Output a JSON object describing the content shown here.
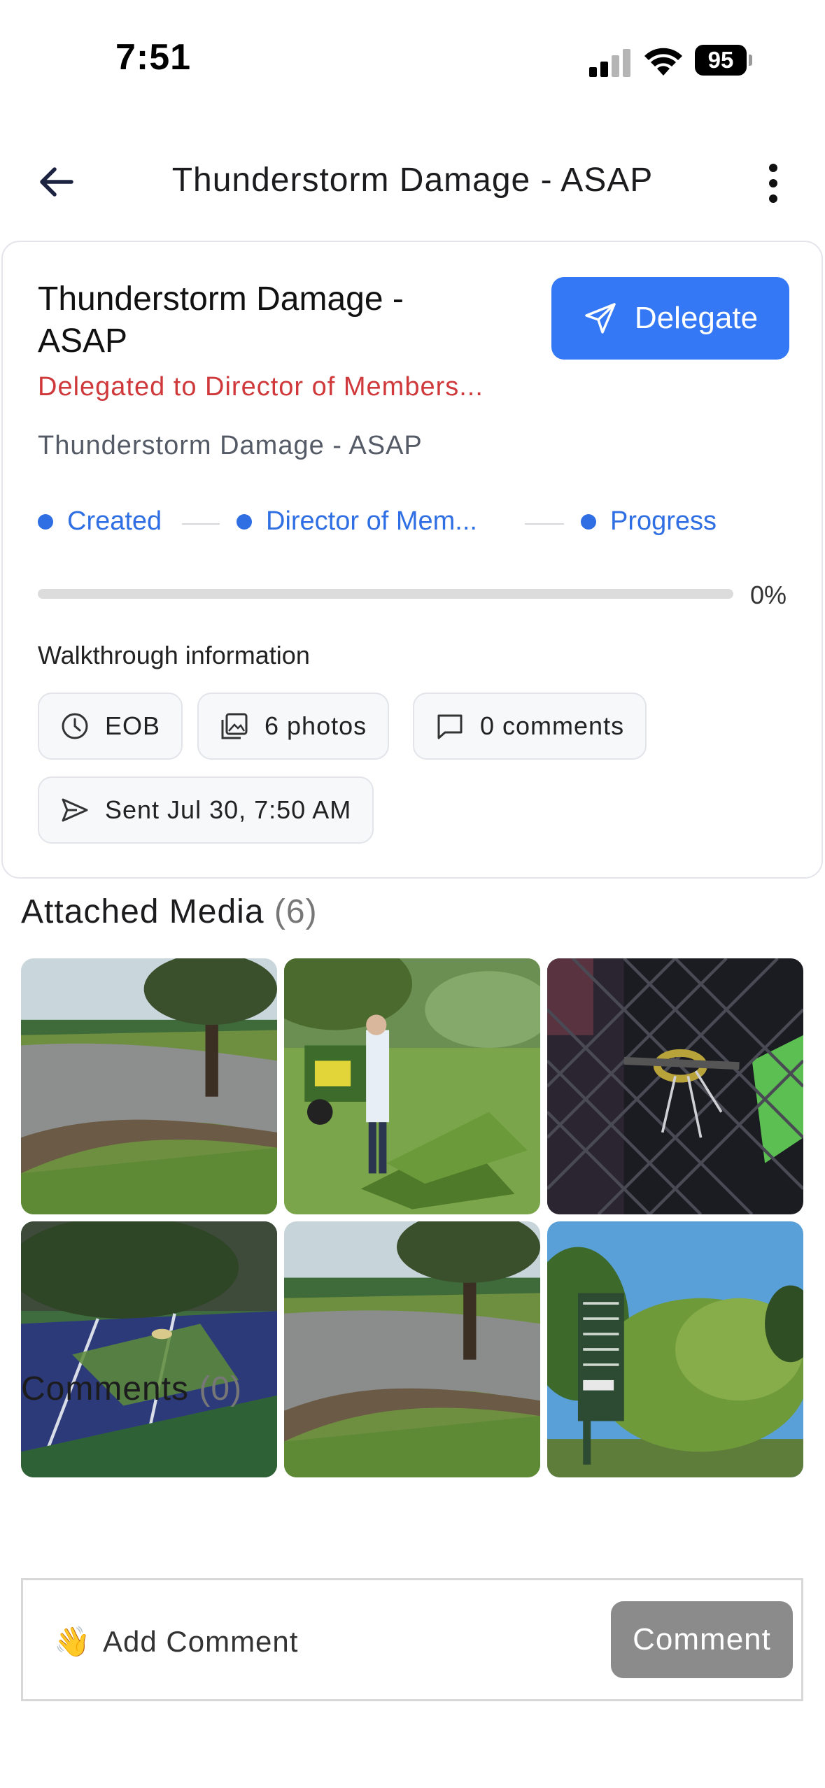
{
  "status_bar": {
    "time": "7:51",
    "battery": "95"
  },
  "nav": {
    "title": "Thunderstorm Damage - ASAP"
  },
  "card": {
    "title": "Thunderstorm Damage - ASAP",
    "delegate_label": "Delegate",
    "delegated_text": "Delegated to Director  of Members...",
    "subtitle": "Thunderstorm Damage - ASAP",
    "steps": [
      "Created",
      "Director  of Mem...",
      "Progress"
    ],
    "progress": 0,
    "progress_label": "0%",
    "walkthrough_label": "Walkthrough information",
    "chips": {
      "due": "EOB",
      "photos": "6 photos",
      "comments": "0 comments",
      "sent": "Sent Jul 30, 7:50 AM"
    },
    "colors": {
      "accent": "#3478f6",
      "alert": "#d0393b"
    }
  },
  "media": {
    "heading": "Attached Media",
    "count": "(6)",
    "items": [
      "flooded-fairway-photo",
      "fallen-branches-cart-photo",
      "torn-netting-photo",
      "debris-on-court-photo",
      "flooded-path-photo",
      "broken-tree-signpost-photo"
    ]
  },
  "comments": {
    "heading": "Comments",
    "count": "(0)",
    "emoji": "👋",
    "placeholder": "Add Comment",
    "button_label": "Comment"
  }
}
